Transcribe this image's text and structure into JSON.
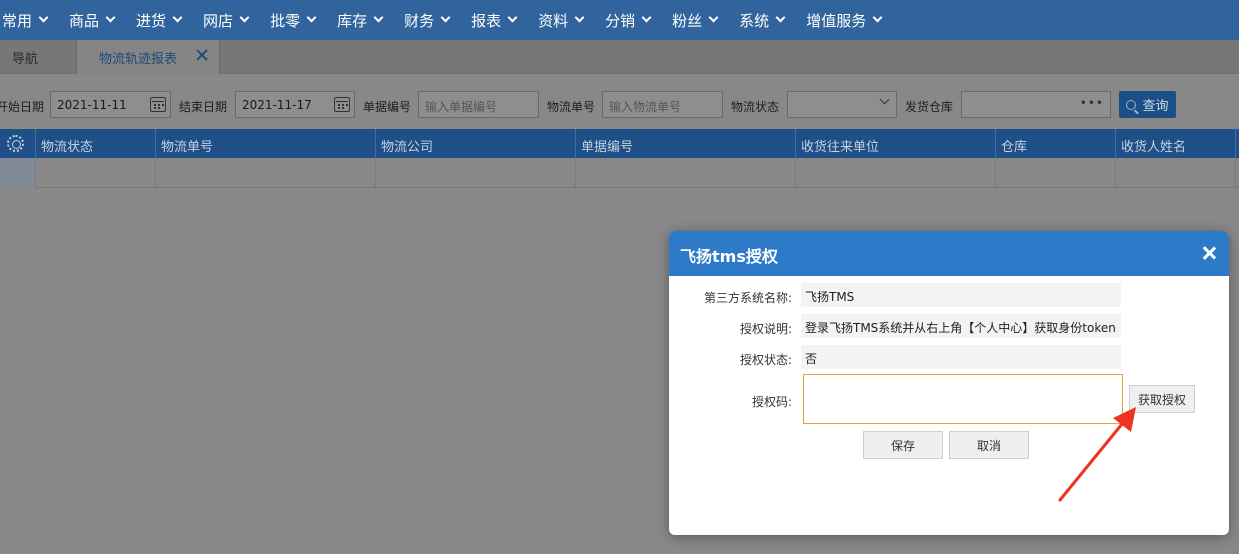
{
  "menu": [
    {
      "label": "常用"
    },
    {
      "label": "商品"
    },
    {
      "label": "进货"
    },
    {
      "label": "网店"
    },
    {
      "label": "批零"
    },
    {
      "label": "库存"
    },
    {
      "label": "财务"
    },
    {
      "label": "报表"
    },
    {
      "label": "资料"
    },
    {
      "label": "分销"
    },
    {
      "label": "粉丝"
    },
    {
      "label": "系统"
    },
    {
      "label": "增值服务"
    }
  ],
  "tabs": {
    "nav_label": "导航",
    "active_label": "物流轨迹报表"
  },
  "filters": {
    "start_date_label": "开始日期",
    "start_date_value": "2021-11-11",
    "end_date_label": "结束日期",
    "end_date_value": "2021-11-17",
    "doc_no_label": "单据编号",
    "doc_no_placeholder": "输入单据编号",
    "tracking_no_label": "物流单号",
    "tracking_no_placeholder": "输入物流单号",
    "status_label": "物流状态",
    "status_value": "",
    "warehouse_label": "发货仓库",
    "warehouse_value": "",
    "query_label": "查询"
  },
  "grid": {
    "columns": [
      "物流状态",
      "物流单号",
      "物流公司",
      "单据编号",
      "收货往来单位",
      "仓库",
      "收货人姓名"
    ]
  },
  "modal": {
    "title": "飞扬tms授权",
    "system_name_label": "第三方系统名称:",
    "system_name_value": "飞扬TMS",
    "description_label": "授权说明:",
    "description_value": "登录飞扬TMS系统并从右上角【个人中心】获取身份token",
    "status_label": "授权状态:",
    "status_value": "否",
    "code_label": "授权码:",
    "code_value": "",
    "get_auth_label": "获取授权",
    "save_label": "保存",
    "cancel_label": "取消"
  },
  "colors": {
    "menu_bg": "#31649c",
    "modal_header": "#2d7bc8",
    "annotation_arrow": "#ee3322",
    "textarea_border": "#e3a33a"
  }
}
